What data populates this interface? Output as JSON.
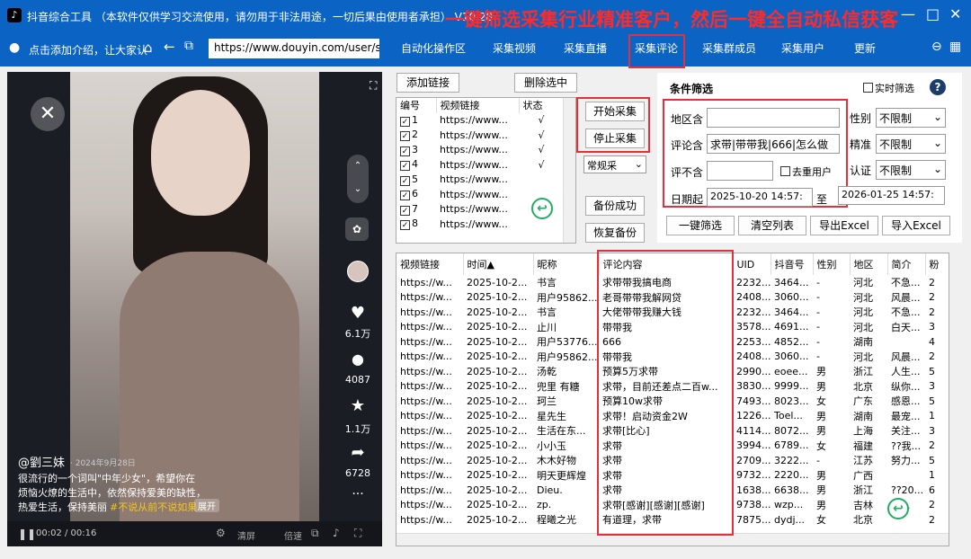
{
  "window": {
    "title": "抖音综合工具 （本软件仅供学习交流使用，请勿用于非法用途，一切后果由使用者承担） V10.28",
    "promo": "一键筛选采集行业精准客户，然后一键全自动私信获客",
    "btn_min": "—",
    "btn_max": "□",
    "btn_close": "✕"
  },
  "toolbar": {
    "intro": "点击添加介绍，让大家认",
    "url": "https://www.douyin.com/user/se",
    "tabs": [
      "自动化操作区",
      "采集视频",
      "采集直播",
      "采集评论",
      "采集群成员",
      "采集用户",
      "更新"
    ]
  },
  "video": {
    "author": "@劉三妹",
    "date": "· 2024年9月28日",
    "caption1": "很流行的一个词叫\"中年少女\"，希望你在",
    "caption2": "烦恼火燎的生活中，依然保持爱美的缺性，",
    "caption3": "热爱生活，保持美丽",
    "caption_tag": "#不说从前不说如果...",
    "expand": "展开",
    "likes": "6.1万",
    "comments": "4087",
    "stars": "1.1万",
    "shares": "6728",
    "time": "00:02 / 00:16",
    "controls": [
      "清屏",
      "倍速"
    ],
    "more": "···"
  },
  "links": {
    "add": "添加链接",
    "delete": "删除选中",
    "headers": [
      "编号",
      "视频链接",
      "状态"
    ],
    "rows": [
      {
        "id": "1",
        "url": "https://www...",
        "status": "√"
      },
      {
        "id": "2",
        "url": "https://www...",
        "status": "√"
      },
      {
        "id": "3",
        "url": "https://www...",
        "status": "√"
      },
      {
        "id": "4",
        "url": "https://www...",
        "status": "√"
      },
      {
        "id": "5",
        "url": "https://www...",
        "status": ""
      },
      {
        "id": "6",
        "url": "https://www...",
        "status": ""
      },
      {
        "id": "7",
        "url": "https://www...",
        "status": ""
      },
      {
        "id": "8",
        "url": "https://www...",
        "status": ""
      }
    ]
  },
  "actions": {
    "start": "开始采集",
    "stop": "停止采集",
    "mode": "常规采",
    "backup": "备份成功",
    "restore": "恢复备份"
  },
  "filter": {
    "title": "条件筛选",
    "realtime": "实时筛选",
    "help": "?",
    "region_label": "地区含",
    "region_value": "",
    "comment_label": "评论含",
    "comment_value": "求带|带带我|666|怎么做",
    "exclude_label": "评不含",
    "exclude_value": "",
    "dedupe": "去重用户",
    "gender_label": "性别",
    "gender_value": "不限制",
    "precise_label": "精准",
    "precise_value": "不限制",
    "verify_label": "认证",
    "verify_value": "不限制",
    "date_label": "日期起",
    "date_from": "2025-10-20 14:57:",
    "date_to_label": "至",
    "date_to": "2026-01-25 14:57:",
    "btn_filter": "一键筛选",
    "btn_clear": "清空列表",
    "btn_export": "导出Excel",
    "btn_import": "导入Excel"
  },
  "results": {
    "headers": [
      "视频链接",
      "时间▲",
      "昵称",
      "评论内容",
      "UID",
      "抖音号",
      "性别",
      "地区",
      "简介",
      "粉"
    ],
    "rows": [
      [
        "https://w...",
        "2025-10-2...",
        "书言",
        "求带带我搞电商",
        "2232...",
        "3464...",
        "-",
        "河北",
        "不急...",
        "2"
      ],
      [
        "https://w...",
        "2025-10-2...",
        "用户95862...",
        "老哥带带我解网贷",
        "2408...",
        "3060...",
        "-",
        "河北",
        "风晨...",
        "2"
      ],
      [
        "https://w...",
        "2025-10-2...",
        "书言",
        "大佬带带我赚大钱",
        "2232...",
        "3464...",
        "-",
        "河北",
        "不急...",
        "2"
      ],
      [
        "https://w...",
        "2025-10-2...",
        "止川",
        "带带我",
        "3578...",
        "4691...",
        "-",
        "河北",
        "白天...",
        "3"
      ],
      [
        "https://w...",
        "2025-10-2...",
        "用户53776...",
        "666",
        "2253...",
        "4852...",
        "-",
        "湖南",
        "",
        "4"
      ],
      [
        "https://w...",
        "2025-10-2...",
        "用户95862...",
        "带带我",
        "2408...",
        "3060...",
        "-",
        "河北",
        "风晨...",
        "2"
      ],
      [
        "https://w...",
        "2025-10-2...",
        "汤乾",
        "预算5万求带",
        "2990...",
        "eoee...",
        "男",
        "浙江",
        "人生...",
        "5"
      ],
      [
        "https://w...",
        "2025-10-2...",
        "兜里 有糖",
        "求带，目前还差点二百w...",
        "3830...",
        "9999...",
        "男",
        "北京",
        "纵你...",
        "3"
      ],
      [
        "https://w...",
        "2025-10-2...",
        "珂兰",
        "预算10w求带",
        "7493...",
        "8023...",
        "女",
        "广东",
        "感恩...",
        "5"
      ],
      [
        "https://w...",
        "2025-10-2...",
        "星先生",
        "求带！启动资金2W",
        "1226...",
        "Toel...",
        "男",
        "湖南",
        "最宠...",
        "1"
      ],
      [
        "https://w...",
        "2025-10-2...",
        "生活在东...",
        "求带[比心]",
        "4114...",
        "8072...",
        "男",
        "上海",
        "关注...",
        "3"
      ],
      [
        "https://w...",
        "2025-10-2...",
        "小小玉",
        "求带",
        "3994...",
        "6789...",
        "女",
        "福建",
        "??我...",
        "2"
      ],
      [
        "https://w...",
        "2025-10-2...",
        "木木好物",
        "求带",
        "2709...",
        "3222...",
        "-",
        "江苏",
        "努力...",
        "5"
      ],
      [
        "https://w...",
        "2025-10-2...",
        "明天更辉煌",
        "求带",
        "9732...",
        "2220...",
        "男",
        "广西",
        "",
        "1"
      ],
      [
        "https://w...",
        "2025-10-2...",
        "Dieu.",
        "求带",
        "1638...",
        "6638...",
        "男",
        "浙江",
        "??20...",
        "6"
      ],
      [
        "https://w...",
        "2025-10-2...",
        "zp.",
        "求带[感谢][感谢][感谢]",
        "9738...",
        "wzp...",
        "男",
        "吉林",
        "心...",
        "2"
      ],
      [
        "https://w...",
        "2025-10-2...",
        "程曦之光",
        "有道理，求带",
        "7875...",
        "dydj...",
        "女",
        "北京",
        "",
        "2"
      ]
    ]
  }
}
